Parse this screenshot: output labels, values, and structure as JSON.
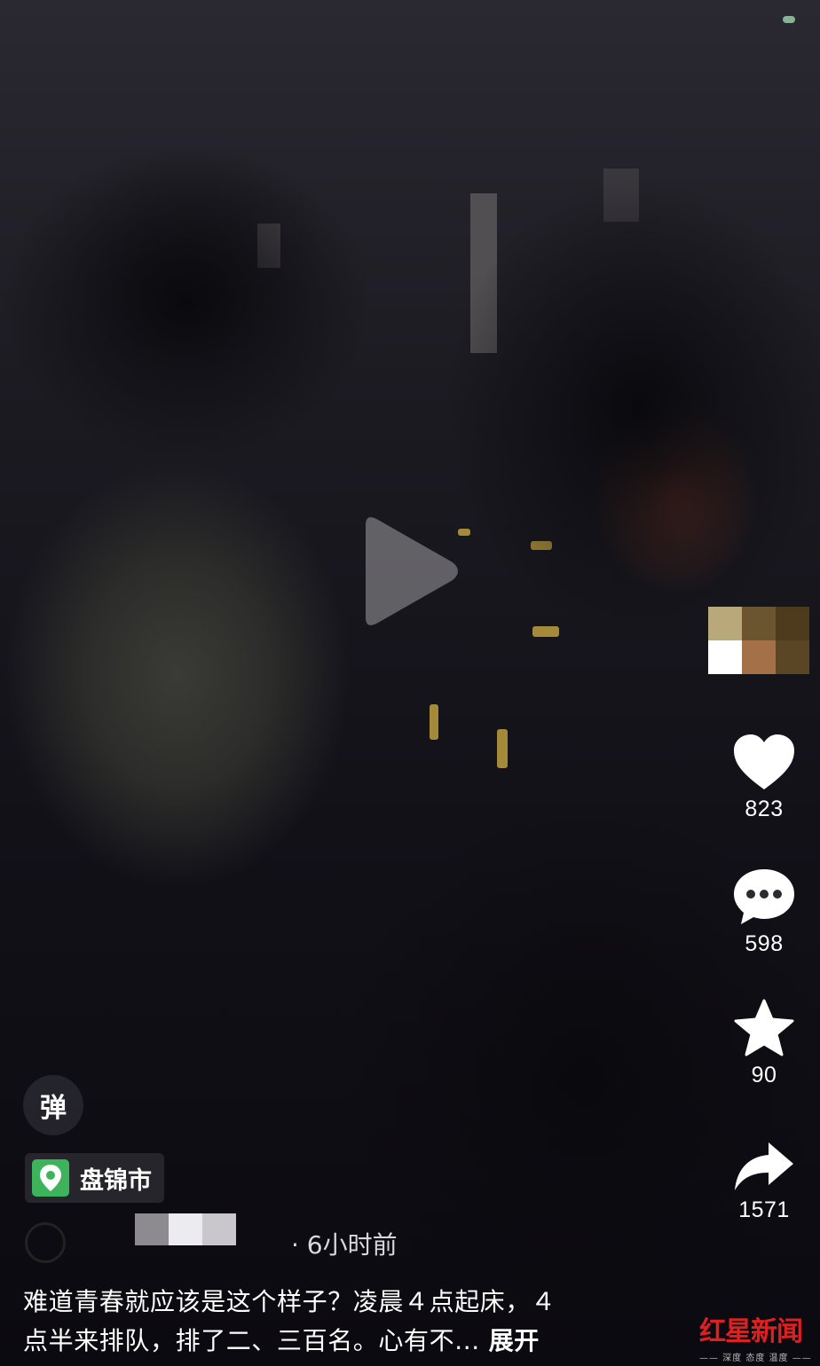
{
  "video": {
    "background": "#121118",
    "play_icon": "play-icon"
  },
  "sidebar": {
    "avatar": "user-avatar",
    "like": {
      "icon": "heart-icon",
      "count": "823"
    },
    "comment": {
      "icon": "comment-bubble-icon",
      "count": "598"
    },
    "favorite": {
      "icon": "star-icon",
      "count": "90"
    },
    "share": {
      "icon": "share-arrow-icon",
      "count": "1571"
    }
  },
  "danmu": {
    "label": "弹"
  },
  "location": {
    "icon": "location-pin-icon",
    "name": "盘锦市"
  },
  "post": {
    "time": "· 6小时前",
    "caption_line1": "难道青春就应该是这个样子？凌晨４点起床，４",
    "caption_line2": "点半来排队，排了二、三百名。心有不...",
    "expand_label": "展开"
  },
  "watermark": {
    "logo_text": "红星新闻",
    "sub_text": "—— 深度 态度 温度 ——"
  },
  "colors": {
    "accent_green": "#3db45c",
    "watermark_red": "#e02020"
  }
}
